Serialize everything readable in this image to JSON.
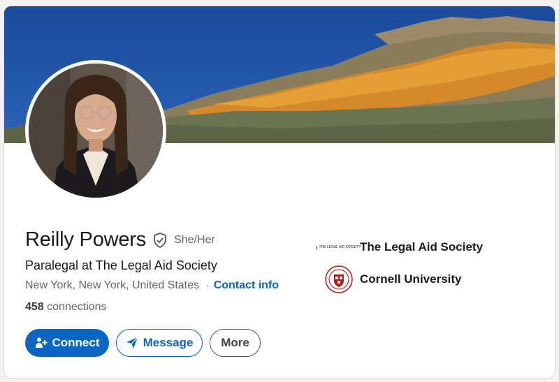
{
  "profile": {
    "name": "Reilly Powers",
    "pronouns": "She/Her",
    "headline": "Paralegal at The Legal Aid Society",
    "location": "New York, New York, United States",
    "contact_separator": "·",
    "contact_label": "Contact info",
    "connections_count": "458",
    "connections_label": "connections"
  },
  "actions": {
    "connect_label": "Connect",
    "message_label": "Message",
    "more_label": "More"
  },
  "organizations": [
    {
      "name": "The Legal Aid Society",
      "logo": "legal-aid-society-logo",
      "logo_text": "THE LEGAL AID SOCIETY"
    },
    {
      "name": "Cornell University",
      "logo": "cornell-seal-logo"
    }
  ],
  "colors": {
    "accent": "#0a66c2",
    "text_primary": "#1a1a1a",
    "text_secondary": "#666666",
    "cornell_red": "#b31b1b"
  },
  "icons": {
    "verified": "shield-check-icon",
    "connect": "person-add-icon",
    "message": "paper-plane-icon"
  }
}
